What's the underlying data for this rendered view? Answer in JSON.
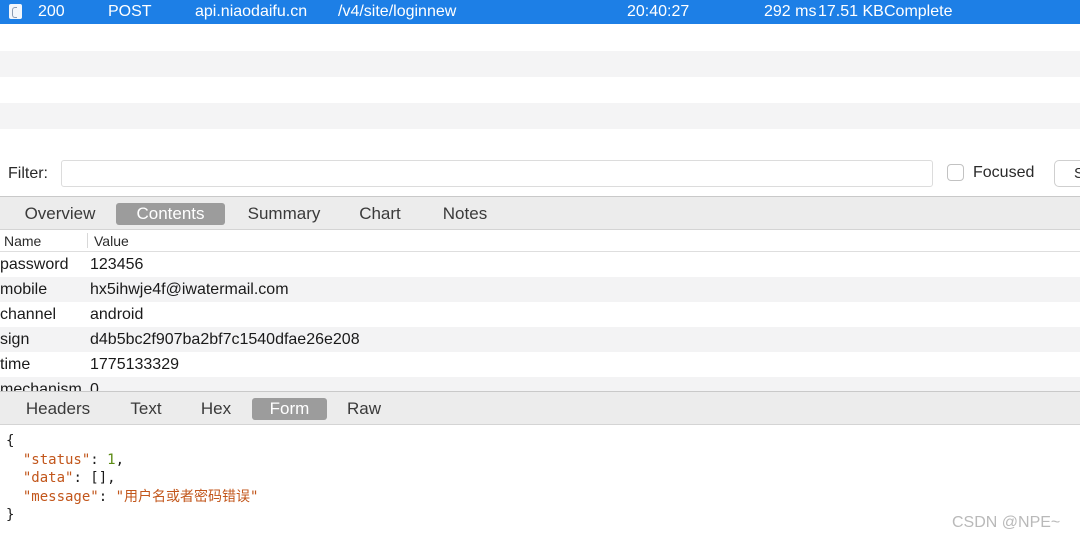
{
  "request": {
    "status": "200",
    "method": "POST",
    "host": "api.niaodaifu.cn",
    "path": "/v4/site/loginnew",
    "time": "20:40:27",
    "duration": "292 ms",
    "size": "17.51 KB",
    "state": "Complete"
  },
  "filter": {
    "label": "Filter:",
    "value": "",
    "focused_label": "Focused",
    "button_partial": "S"
  },
  "request_tabs": [
    {
      "label": "Overview",
      "active": false
    },
    {
      "label": "Contents",
      "active": true
    },
    {
      "label": "Summary",
      "active": false
    },
    {
      "label": "Chart",
      "active": false
    },
    {
      "label": "Notes",
      "active": false
    }
  ],
  "table": {
    "headers": [
      "Name",
      "Value"
    ],
    "rows": [
      {
        "name": "password",
        "value": "123456"
      },
      {
        "name": "mobile",
        "value": "hx5ihwje4f@iwatermail.com"
      },
      {
        "name": "channel",
        "value": "android"
      },
      {
        "name": "sign",
        "value": "d4b5bc2f907ba2bf7c1540dfae26e208"
      },
      {
        "name": "time",
        "value": "1775133329"
      },
      {
        "name": "mechanism",
        "value": "0"
      }
    ]
  },
  "response_tabs": [
    {
      "label": "Headers",
      "active": false
    },
    {
      "label": "Text",
      "active": false
    },
    {
      "label": "Hex",
      "active": false
    },
    {
      "label": "Form",
      "active": true
    },
    {
      "label": "Raw",
      "active": false
    }
  ],
  "response": {
    "open_brace": "{",
    "close_brace": "}",
    "fields": [
      {
        "key": "\"status\"",
        "value": "1",
        "kind": "number",
        "trail": ","
      },
      {
        "key": "\"data\"",
        "value": "[]",
        "kind": "plain",
        "trail": ","
      },
      {
        "key": "\"message\"",
        "value": "\"用户名或者密码错误\"",
        "kind": "string",
        "trail": ""
      }
    ]
  },
  "watermark": "CSDN @NPE~",
  "colors": {
    "selection": "#1d7fe6",
    "active_tab": "#9c9c9c",
    "json_key": "#c2561b",
    "json_number": "#5a8a12"
  },
  "icons": {
    "request_row": "document-icon"
  }
}
